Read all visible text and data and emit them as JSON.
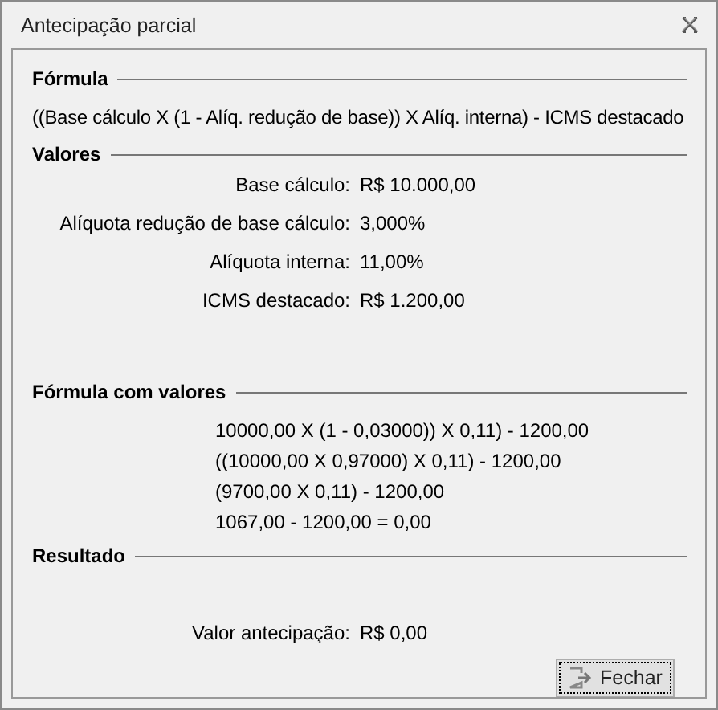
{
  "window": {
    "title": "Antecipação parcial"
  },
  "formula": {
    "heading": "Fórmula",
    "text": "((Base cálculo X (1 - Alíq. redução de base)) X Alíq. interna) - ICMS destacado"
  },
  "values": {
    "heading": "Valores",
    "rows": [
      {
        "label": "Base cálculo:",
        "value": "R$ 10.000,00"
      },
      {
        "label": "Alíquota redução de base cálculo:",
        "value": "3,000%"
      },
      {
        "label": "Alíquota interna:",
        "value": "11,00%"
      },
      {
        "label": "ICMS destacado:",
        "value": "R$ 1.200,00"
      }
    ]
  },
  "formula_with_values": {
    "heading": "Fórmula com valores",
    "lines": [
      "10000,00 X (1 - 0,03000)) X 0,11) - 1200,00",
      "((10000,00 X 0,97000) X 0,11) - 1200,00",
      "(9700,00 X 0,11) - 1200,00",
      "1067,00 - 1200,00 = 0,00"
    ]
  },
  "result": {
    "heading": "Resultado",
    "label": "Valor antecipação:",
    "value": "R$ 0,00"
  },
  "buttons": [
    {
      "label": "Fechar"
    }
  ]
}
